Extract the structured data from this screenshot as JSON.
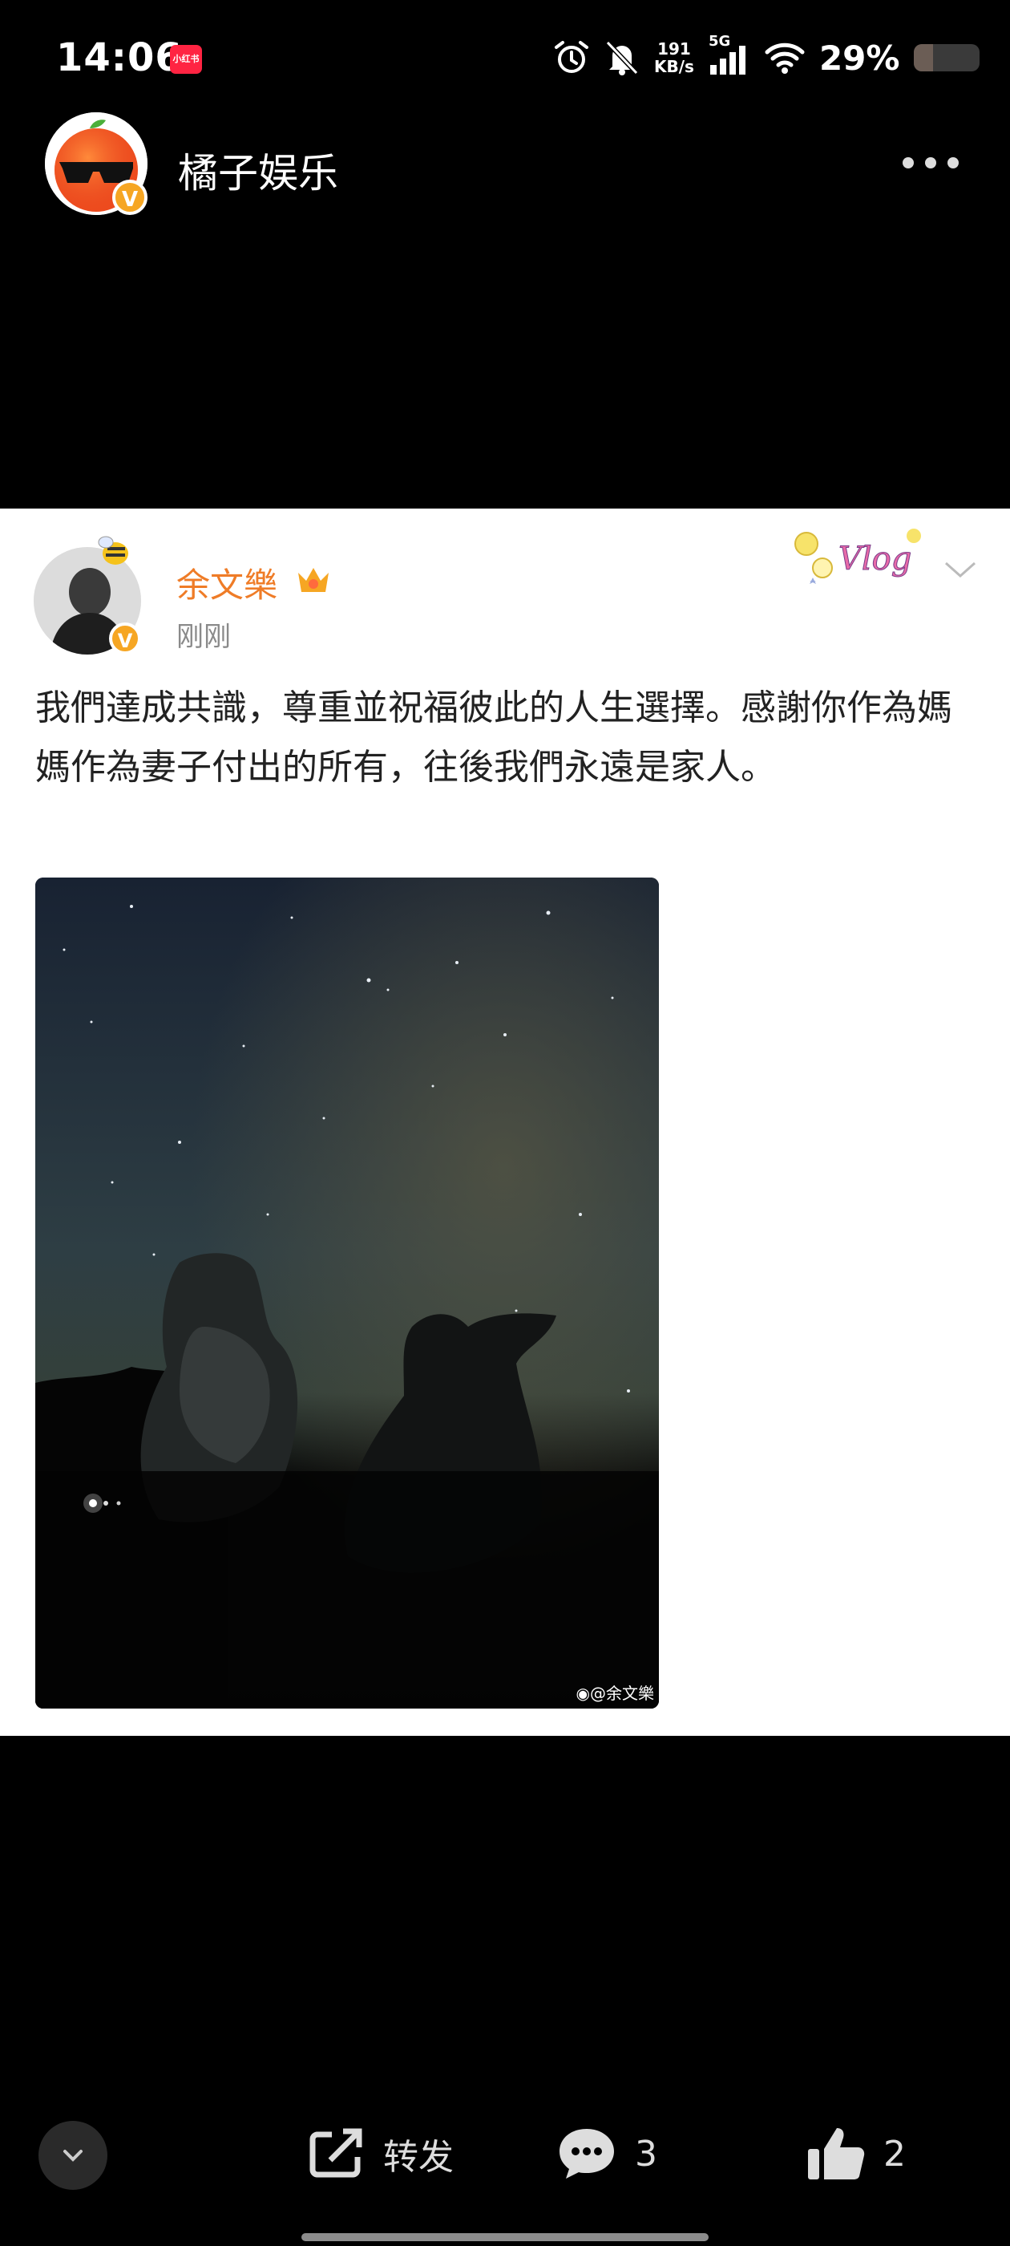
{
  "status": {
    "time": "14:06",
    "app_badge": "小红书",
    "net_speed_value": "191",
    "net_speed_unit": "KB/s",
    "network": "5G",
    "battery_percent": "29%",
    "battery_level": 0.29,
    "icons": [
      "alarm-icon",
      "mute-icon",
      "signal-icon",
      "wifi-icon",
      "battery-icon"
    ]
  },
  "header": {
    "account_name": "橘子娱乐",
    "verified_badge": "V"
  },
  "post": {
    "author": "余文樂",
    "verified_badge": "V",
    "time": "刚刚",
    "sticker_text": "Vlog",
    "text": "我們達成共識，尊重並祝福彼此的人生選擇。感謝你作為媽媽作為妻子付出的所有，往後我們永遠是家人。",
    "image_watermark": "@余文樂"
  },
  "actions": {
    "repost_label": "转发",
    "comment_count": "3",
    "like_count": "2"
  },
  "colors": {
    "author_name": "#ef7c27",
    "verified": "#f6a623",
    "background": "#000000",
    "card": "#ffffff"
  }
}
